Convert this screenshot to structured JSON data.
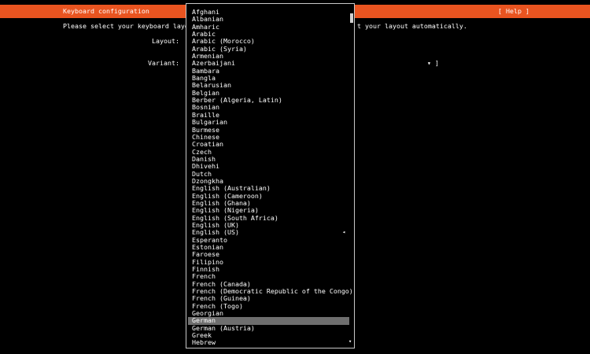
{
  "header": {
    "title": "Keyboard configuration",
    "help": "[ Help ]"
  },
  "prompt": {
    "left": "Please select your keyboard layou",
    "right": "t your layout automatically."
  },
  "fields": {
    "layout_label": "Layout:",
    "variant_label": "Variant:",
    "variant_suffix": "▾ ]"
  },
  "dropdown": {
    "items": [
      "Afghani",
      "Albanian",
      "Amharic",
      "Arabic",
      "Arabic (Morocco)",
      "Arabic (Syria)",
      "Armenian",
      "Azerbaijani",
      "Bambara",
      "Bangla",
      "Belarusian",
      "Belgian",
      "Berber (Algeria, Latin)",
      "Bosnian",
      "Braille",
      "Bulgarian",
      "Burmese",
      "Chinese",
      "Croatian",
      "Czech",
      "Danish",
      "Dhivehi",
      "Dutch",
      "Dzongkha",
      "English (Australian)",
      "English (Cameroon)",
      "English (Ghana)",
      "English (Nigeria)",
      "English (South Africa)",
      "English (UK)",
      "English (US)",
      "Esperanto",
      "Estonian",
      "Faroese",
      "Filipino",
      "Finnish",
      "French",
      "French (Canada)",
      "French (Democratic Republic of the Congo)",
      "French (Guinea)",
      "French (Togo)",
      "Georgian",
      "German",
      "German (Austria)",
      "Greek",
      "Hebrew"
    ],
    "selected_item": "German",
    "current_item": "English (US)",
    "current_marker": "◂",
    "scroll_down_marker": "▾"
  }
}
